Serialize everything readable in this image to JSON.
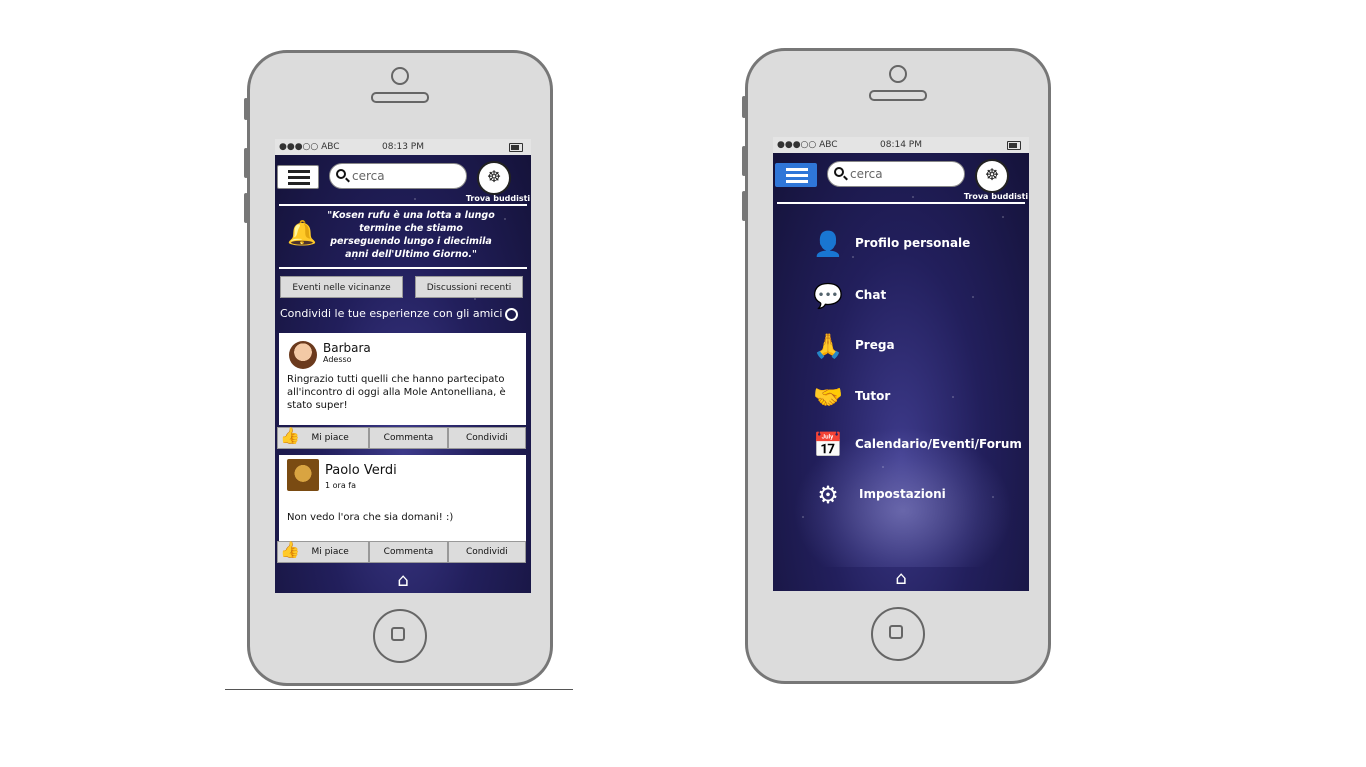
{
  "left_phone": {
    "status": {
      "carrier": "●●●○○ ABC",
      "time": "08:13 PM"
    },
    "search_placeholder": "cerca",
    "buddha_label": "Trova buddisti",
    "quote": "\"Kosen rufu è una lotta a lungo termine che stiamo perseguendo lungo i diecimila anni dell'Ultimo Giorno.\"",
    "tabs": [
      "Eventi nelle vicinanze",
      "Discussioni recenti"
    ],
    "share_text": "Condividi le tue esperienze con gli amici",
    "posts": [
      {
        "name": "Barbara",
        "when": "Adesso",
        "body": " Ringrazio tutti quelli che hanno partecipato all'incontro di oggi alla Mole  Antonelliana, è stato super!",
        "actions": [
          "Mi piace",
          "Commenta",
          "Condividi"
        ]
      },
      {
        "name": "Paolo Verdi",
        "when": "1 ora fa",
        "body": "Non vedo l'ora che sia domani! :)",
        "actions": [
          "Mi piace",
          "Commenta",
          "Condividi"
        ]
      }
    ]
  },
  "right_phone": {
    "status": {
      "carrier": "●●●○○ ABC",
      "time": "08:14 PM"
    },
    "search_placeholder": "cerca",
    "buddha_label": "Trova buddisti",
    "menu": [
      {
        "label": "Profilo personale",
        "icon": "user-icon"
      },
      {
        "label": "Chat",
        "icon": "chat-icon"
      },
      {
        "label": "Prega",
        "icon": "pray-icon"
      },
      {
        "label": "Tutor",
        "icon": "handshake-icon"
      },
      {
        "label": "Calendario/Eventi/Forum",
        "icon": "calendar-icon"
      },
      {
        "label": "Impostazioni",
        "icon": "gear-icon"
      }
    ]
  }
}
